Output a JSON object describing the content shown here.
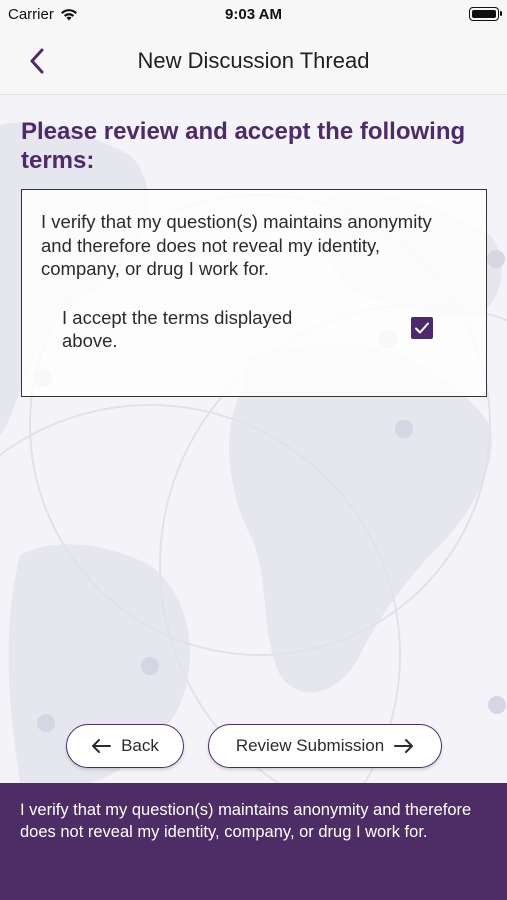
{
  "status_bar": {
    "carrier": "Carrier",
    "time": "9:03 AM",
    "wifi_icon": "wifi-icon",
    "battery_icon": "battery-icon"
  },
  "nav": {
    "back_icon": "chevron-left-icon",
    "title": "New Discussion Thread"
  },
  "main": {
    "heading": "Please review and accept the following terms:",
    "terms_text": "I verify that my question(s) maintains anonymity and therefore does not reveal my identity, company, or drug I work for.",
    "accept_label": "I accept the terms displayed above.",
    "accept_checked": true
  },
  "buttons": {
    "back_label": "Back",
    "back_icon": "arrow-left-icon",
    "review_label": "Review Submission",
    "review_icon": "arrow-right-icon"
  },
  "footer": {
    "text": "I verify that my question(s) maintains anonymity and therefore does not reveal my identity, company, or drug I work for."
  },
  "colors": {
    "brand_purple": "#4e2a6c",
    "footer_bg": "#4e2c65",
    "background": "#f4f4f8"
  }
}
